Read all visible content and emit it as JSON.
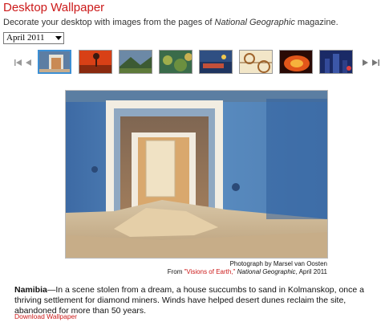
{
  "header": {
    "title": "Desktop Wallpaper",
    "subtitle_prefix": "Decorate your desktop with images from the pages of ",
    "subtitle_magazine": "National Geographic",
    "subtitle_suffix": " magazine."
  },
  "month_select": {
    "value": "April 2011"
  },
  "carousel": {
    "first_icon": "first-page-icon",
    "prev_icon": "previous-icon",
    "next_icon": "next-icon",
    "last_icon": "last-page-icon",
    "selected_index": 0,
    "thumbnail_count": 8
  },
  "photo": {
    "credit_line": "Photograph by Marsel van Oosten",
    "source_prefix": "From ",
    "source_link": "\"Visions of Earth,\"",
    "source_magazine": "National Geographic",
    "source_date": ", April 2011"
  },
  "description": {
    "place": "Namibia",
    "text": "—In a scene stolen from a dream, a house succumbs to sand in Kolmanskop, once a thriving settlement for diamond miners. Winds have helped desert dunes reclaim the site, abandoned for more than 50 years."
  },
  "download": {
    "label": "Download Wallpaper"
  },
  "colors": {
    "accent": "#cc1a1a",
    "selected_border": "#3c8fd4"
  }
}
